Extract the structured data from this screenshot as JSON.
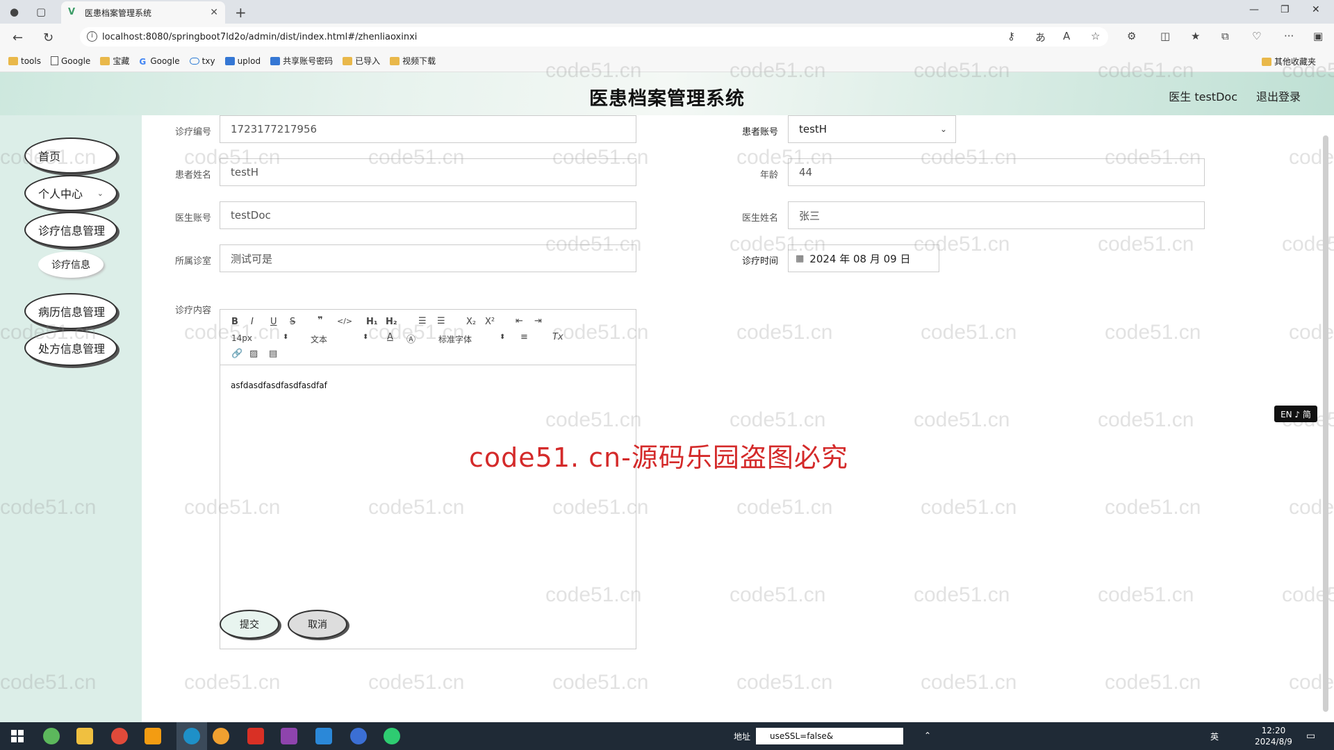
{
  "browser": {
    "tab_title": "医患档案管理系统",
    "url": "localhost:8080/springboot7ld2o/admin/dist/index.html#/zhenliaoxinxi",
    "bookmarks": [
      "tools",
      "Google",
      "宝藏",
      "Google",
      "txy",
      "uplod",
      "共享账号密码",
      "已导入",
      "视频下载"
    ],
    "bookmarks_right": "其他收藏夹"
  },
  "header": {
    "title": "医患档案管理系统",
    "user": "医生 testDoc",
    "logout": "退出登录"
  },
  "sidebar": {
    "items": [
      {
        "label": "首页"
      },
      {
        "label": "个人中心"
      },
      {
        "label": "诊疗信息管理"
      },
      {
        "label": "诊疗信息"
      },
      {
        "label": "病历信息管理"
      },
      {
        "label": "处方信息管理"
      }
    ]
  },
  "form": {
    "diag_no": {
      "label": "诊疗编号",
      "value": "1723177217956"
    },
    "patient_account": {
      "label": "患者账号",
      "value": "testH"
    },
    "patient_name": {
      "label": "患者姓名",
      "value": "testH"
    },
    "age": {
      "label": "年龄",
      "value": "44"
    },
    "doctor_account": {
      "label": "医生账号",
      "value": "testDoc"
    },
    "doctor_name": {
      "label": "医生姓名",
      "value": "张三"
    },
    "clinic": {
      "label": "所属诊室",
      "value": "测试可是"
    },
    "diag_time": {
      "label": "诊疗时间",
      "value": "2024 年 08 月 09 日"
    },
    "content": {
      "label": "诊疗内容",
      "value": "asfdasdfasdfasdfasdfaf"
    },
    "editor_toolbar": {
      "font_size": "14px",
      "text_type": "文本",
      "font_family": "标准字体"
    },
    "submit": "提交",
    "cancel": "取消"
  },
  "watermark": {
    "main": "code51. cn-源码乐园盗图必究",
    "repeat": "code51.cn"
  },
  "ime": "EN ♪ 简",
  "taskbar": {
    "address_label": "地址",
    "address_value": "useSSL=false&",
    "time": "12:20",
    "date": "2024/8/9",
    "lang": "英"
  },
  "colors": {
    "header_gradient": "#cde8de",
    "sidebar_bg": "#dceee8",
    "watermark_red": "#d42a2a",
    "taskbar": "#1f2a36"
  }
}
